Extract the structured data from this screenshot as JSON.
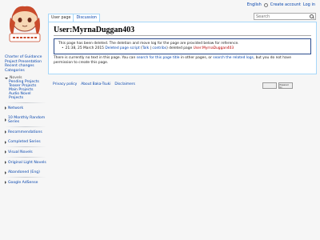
{
  "personal": {
    "language": "English",
    "create_account": "Create account",
    "login": "Log in"
  },
  "tabs": [
    {
      "label": "User page"
    },
    {
      "label": "Discussion"
    }
  ],
  "search": {
    "placeholder": "Search"
  },
  "page": {
    "title": "User:MyrnaDuggan403",
    "notice": "This page has been deleted. The deletion and move log for the page are provided below for reference.",
    "log_entry": {
      "time": "21:38, 25 March 2015",
      "user": "Deleted page script",
      "talk": "Talk",
      "contribs": "contribs",
      "action": "deleted page",
      "target": "User:MyrnaDuggan403"
    },
    "body_prefix": "There is currently no text in this page. You can",
    "search_title_link": "search for this page title",
    "body_mid": "in other pages, or",
    "search_logs_link": "search the related logs",
    "body_suffix": ", but you do not have permission to create this page."
  },
  "sidebar": {
    "nav": [
      "Charter of Guidance",
      "Project Presentation",
      "Recent changes",
      "Categories"
    ],
    "portals": [
      {
        "label": "Novels",
        "expanded": true,
        "items": [
          "Pending Projects",
          "Teaser Projects",
          "Main Projects",
          "Audio Novel Projects"
        ]
      },
      {
        "label": "Network",
        "expanded": false
      },
      {
        "label": "10 Monthly Random Series",
        "expanded": false
      },
      {
        "label": "Recommendations",
        "expanded": false
      },
      {
        "label": "Completed Series",
        "expanded": false
      },
      {
        "label": "Visual Novels",
        "expanded": false
      },
      {
        "label": "Original Light Novels",
        "expanded": false
      },
      {
        "label": "Abandoned (Eng)",
        "expanded": false
      },
      {
        "label": "Google AdSense",
        "expanded": false
      }
    ]
  },
  "footer": {
    "links": [
      "Privacy policy",
      "About Baka-Tsuki",
      "Disclaimers"
    ],
    "badge_mediawiki": "Powered by MediaWiki"
  },
  "colors": {
    "link": "#0645ad",
    "redlink": "#ba0000",
    "border": "#a7d7f9",
    "background": "#f6f6f6"
  }
}
